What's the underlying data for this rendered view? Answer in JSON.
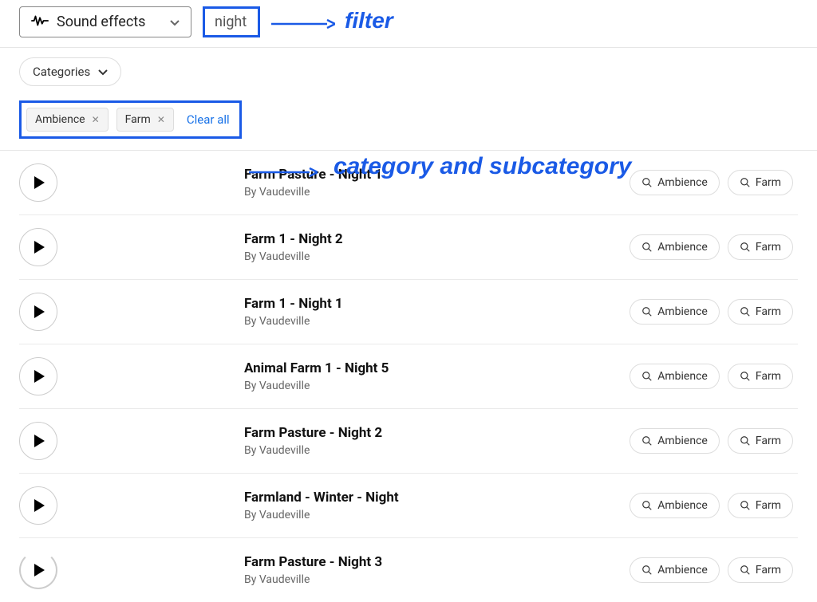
{
  "header": {
    "type_select_label": "Sound effects",
    "search_value": "night"
  },
  "annotations": {
    "filter_label": "filter",
    "category_label": "category and subcategory"
  },
  "filters": {
    "categories_button": "Categories",
    "chips": [
      {
        "label": "Ambience"
      },
      {
        "label": "Farm"
      }
    ],
    "clear_all": "Clear all"
  },
  "tag_labels": {
    "ambience": "Ambience",
    "farm": "Farm"
  },
  "tracks": [
    {
      "title": "Farm Pasture - Night 1",
      "by": "By Vaudeville"
    },
    {
      "title": "Farm 1 - Night 2",
      "by": "By Vaudeville"
    },
    {
      "title": "Farm 1 - Night 1",
      "by": "By Vaudeville"
    },
    {
      "title": "Animal Farm 1 - Night 5",
      "by": "By Vaudeville"
    },
    {
      "title": "Farm Pasture - Night 2",
      "by": "By Vaudeville"
    },
    {
      "title": "Farmland - Winter - Night",
      "by": "By Vaudeville"
    },
    {
      "title": "Farm Pasture - Night 3",
      "by": "By Vaudeville"
    }
  ]
}
